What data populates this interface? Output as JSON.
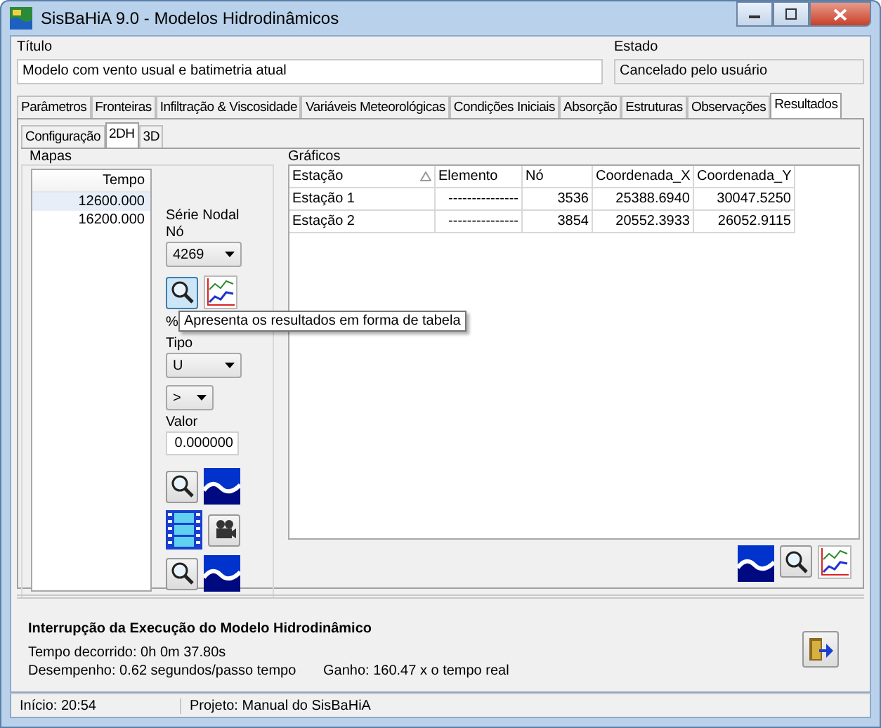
{
  "window": {
    "title": "SisBaHiA 9.0 - Modelos Hidrodinâmicos"
  },
  "header": {
    "title_label": "Título",
    "title_value": "Modelo com vento usual e batimetria atual",
    "state_label": "Estado",
    "state_value": "Cancelado pelo usuário"
  },
  "tabs": [
    {
      "label": "Parâmetros",
      "selected": false
    },
    {
      "label": "Fronteiras",
      "selected": false
    },
    {
      "label": "Infiltração & Viscosidade",
      "selected": false
    },
    {
      "label": "Variáveis Meteorológicas",
      "selected": false
    },
    {
      "label": "Condições Iniciais",
      "selected": false
    },
    {
      "label": "Absorção",
      "selected": false
    },
    {
      "label": "Estruturas",
      "selected": false
    },
    {
      "label": "Observações",
      "selected": false
    },
    {
      "label": "Resultados",
      "selected": true
    }
  ],
  "subtabs": [
    {
      "label": "Configuração",
      "selected": false
    },
    {
      "label": "2DH",
      "selected": true
    },
    {
      "label": "3D",
      "selected": false
    }
  ],
  "maps": {
    "label": "Mapas",
    "column": "Tempo",
    "rows": [
      {
        "value": "12600.000",
        "selected": true
      },
      {
        "value": "16200.000",
        "selected": false
      }
    ]
  },
  "nodal_series": {
    "label": "Série Nodal",
    "node_label": "Nó",
    "node_value": "4269"
  },
  "tooltip": "Apresenta os resultados em forma de tabela",
  "filter": {
    "label": "%",
    "type_label": "Tipo",
    "type_value": "U",
    "operator": ">",
    "value_label": "Valor",
    "value": "0.000000"
  },
  "graphs": {
    "label": "Gráficos",
    "columns": [
      "Estação",
      "Elemento",
      "Nó",
      "Coordenada_X",
      "Coordenada_Y"
    ],
    "rows": [
      [
        "Estação 1",
        "---------------",
        "3536",
        "25388.6940",
        "30047.5250"
      ],
      [
        "Estação 2",
        "---------------",
        "3854",
        "20552.3933",
        "26052.9115"
      ]
    ]
  },
  "footer": {
    "heading": "Interrupção da Execução do Modelo Hidrodinâmico",
    "elapsed": "Tempo decorrido:  0h  0m 37.80s",
    "performance": "Desempenho: 0.62 segundos/passo tempo",
    "gain": "Ganho: 160.47 x o tempo real"
  },
  "status_bar": [
    "Início: 20:54",
    "Projeto: Manual do SisBaHiA"
  ]
}
